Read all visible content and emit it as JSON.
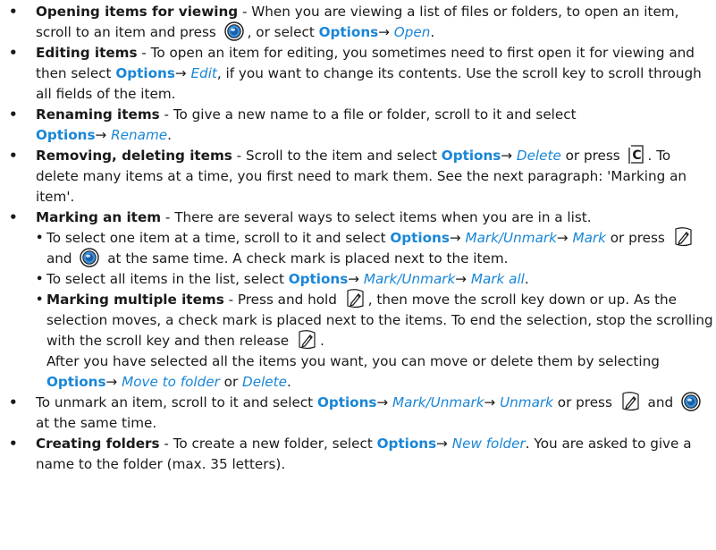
{
  "bullet": "•",
  "sub_bullet": "•",
  "arrow": "→",
  "options": "Options",
  "items": {
    "open": {
      "title": "Opening items for viewing",
      "t1": " - When you are viewing a list of files or folders, to open an item, scroll to an item and press ",
      "t2": ", or select ",
      "cmd": "Open",
      "t3": "."
    },
    "edit": {
      "title": "Editing items",
      "t1": " - To open an item for editing, you sometimes need to first open it for viewing and then select ",
      "cmd": "Edit",
      "t2": ", if you want to change its contents. Use the scroll key to scroll through all fields of the item."
    },
    "rename": {
      "title": "Renaming items",
      "t1": " - To give a new name to a file or folder, scroll to it and select ",
      "cmd": "Rename",
      "t2": "."
    },
    "delete": {
      "title": "Removing, deleting items",
      "t1": " - Scroll to the item and select ",
      "cmd": "Delete",
      "t2": " or press ",
      "t3": ". To delete many items at a time, you first need to mark them. See the next paragraph: 'Marking an item'."
    },
    "mark": {
      "title": "Marking an item",
      "t1": " - There are several ways to select items when you are in a list."
    },
    "sub_one": {
      "t1": "To select one item at a time, scroll to it and select ",
      "cmd1": "Mark/Unmark",
      "cmd2": "Mark",
      "t2": " or press ",
      "t3": " and ",
      "t4": " at the same time. A check mark is placed next to the item."
    },
    "sub_all": {
      "t1": "To select all items in the list, select ",
      "cmd1": "Mark/Unmark",
      "cmd2": "Mark all",
      "t2": "."
    },
    "sub_multi": {
      "title": "Marking multiple items",
      "t1": " - Press and hold ",
      "t2": ", then move the scroll key down or up. As the selection moves, a check mark is placed next to the items. To end the selection, stop the scrolling with the scroll key and then release ",
      "t3": "."
    },
    "sub_after": {
      "t1": "After you have selected all the items you want, you can move or delete them by selecting ",
      "cmd1": "Move to folder",
      "t2": " or ",
      "cmd2": "Delete",
      "t3": "."
    },
    "unmark": {
      "t1": "To unmark an item, scroll to it and select ",
      "cmd1": "Mark/Unmark",
      "cmd2": "Unmark",
      "t2": " or press ",
      "t3": " and ",
      "t4": " at the same time."
    },
    "folders": {
      "title": "Creating folders",
      "t1": " - To create a new folder, select ",
      "cmd": "New folder",
      "t2": ". You are asked to give a name to the folder (max. 35 letters)."
    }
  },
  "icons": {
    "nav": "navi-key-icon",
    "clear": "clear-key-icon",
    "edit": "edit-pen-key-icon"
  },
  "colors": {
    "accent": "#1a86d6",
    "text": "#1a1a1a"
  }
}
